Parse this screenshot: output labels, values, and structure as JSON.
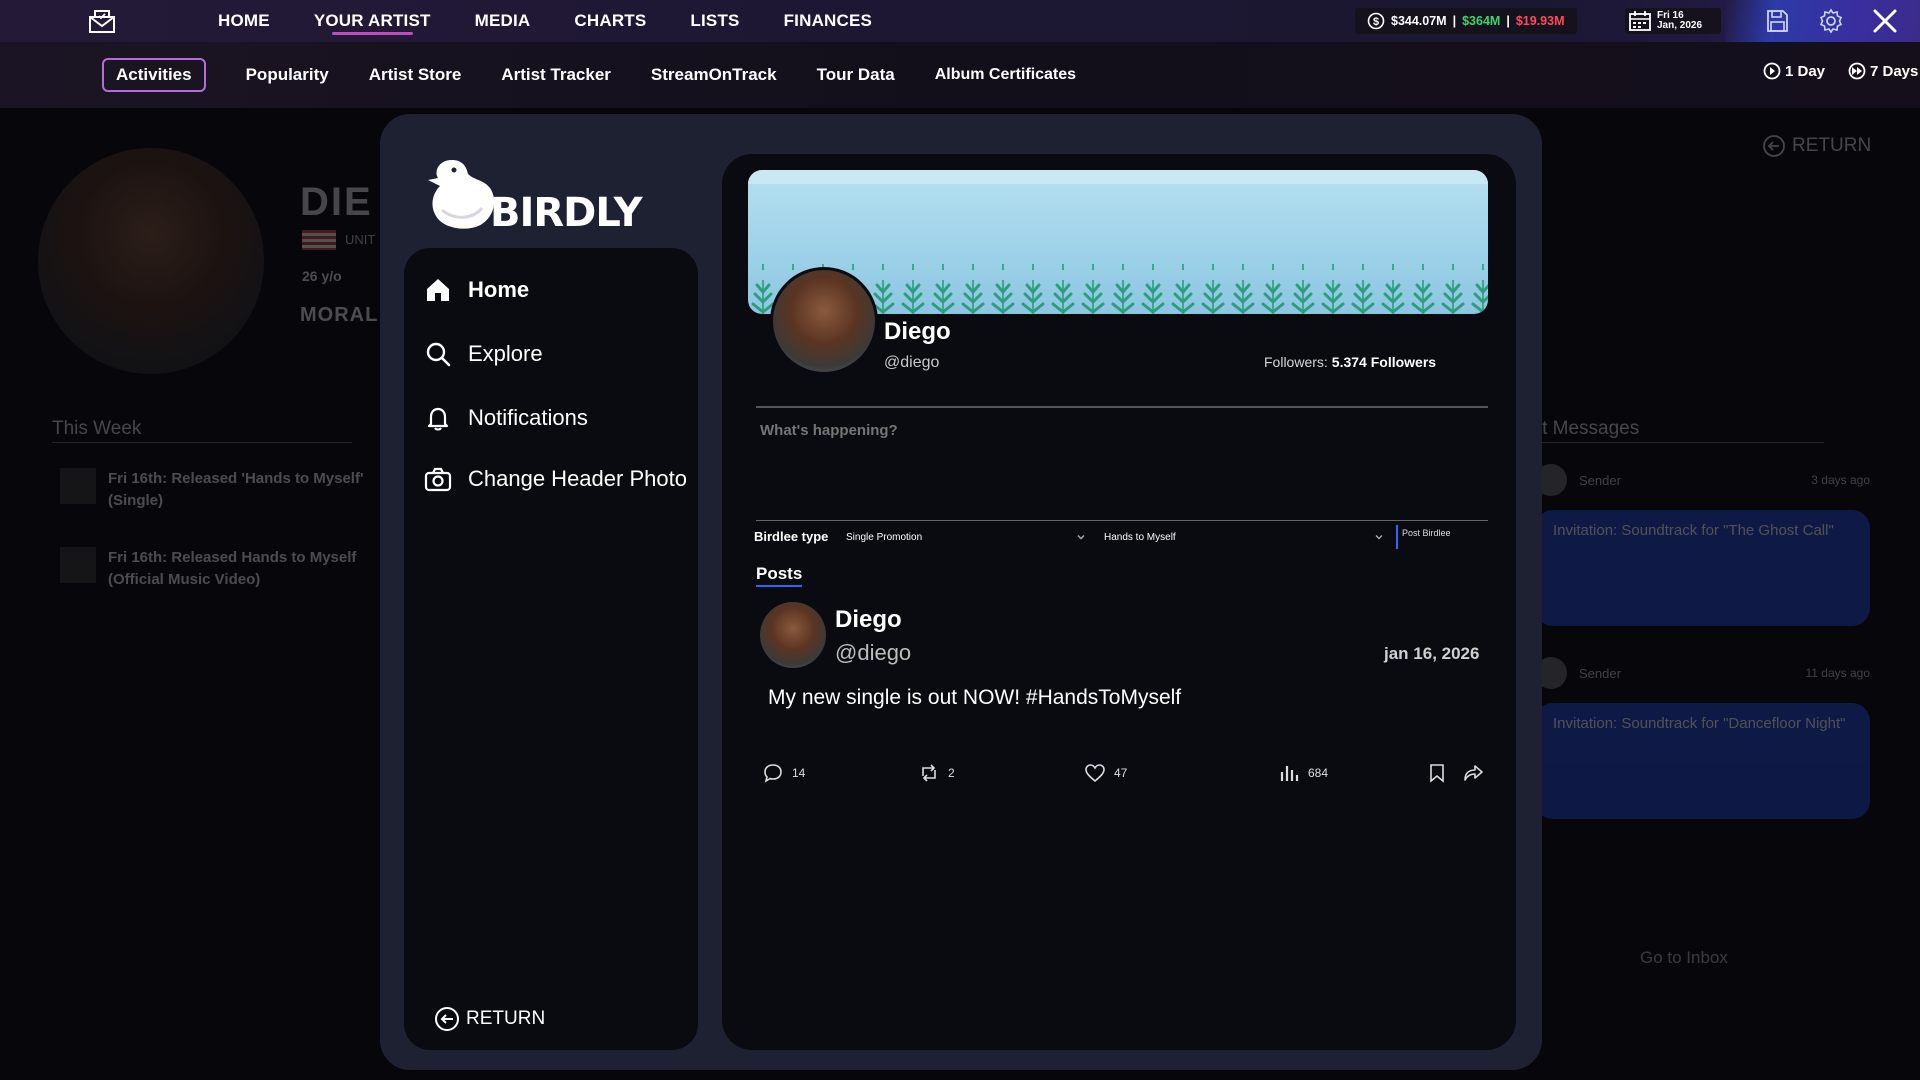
{
  "topnav": {
    "items": [
      "HOME",
      "YOUR ARTIST",
      "MEDIA",
      "CHARTS",
      "LISTS",
      "FINANCES"
    ],
    "active_index": 1
  },
  "finances": {
    "cash": "$344.07M",
    "income": "$364M",
    "expenses": "$19.93M",
    "separator": "|"
  },
  "date": {
    "line1": "Fri 16",
    "line2": "Jan, 2026"
  },
  "subnav": {
    "tabs": [
      "Activities",
      "Popularity",
      "Artist Store",
      "Artist Tracker",
      "StreamOnTrack",
      "Tour Data",
      "Album Certificates"
    ],
    "active_index": 0,
    "advance_1": "1 Day",
    "advance_7": "7 Days"
  },
  "background": {
    "name": "DIE",
    "country": "UNIT",
    "age": "26 y/o",
    "moral": "MORAL",
    "this_week": "This Week",
    "activities": [
      "Fri 16th: Released 'Hands to Myself' (Single)",
      "Fri 16th: Released Hands to Myself (Official Music Video)"
    ],
    "return_label": "RETURN",
    "messages_title": "ast Messages",
    "messages": [
      {
        "sender": "Sender",
        "ago": "3 days ago",
        "text": "Invitation: Soundtrack for \"The Ghost Call\""
      },
      {
        "sender": "Sender",
        "ago": "11 days ago",
        "text": "Invitation: Soundtrack for \"Dancefloor Night\""
      }
    ],
    "inbox": "Go to Inbox"
  },
  "birdly": {
    "logo": "BIRDLY",
    "menu": [
      "Home",
      "Explore",
      "Notifications",
      "Change Header Photo"
    ],
    "return_label": "RETURN"
  },
  "profile": {
    "name": "Diego",
    "handle": "@diego",
    "followers_label": "Followers:",
    "followers_value": "5.374 Followers"
  },
  "compose": {
    "placeholder": "What's happening?",
    "type_label": "Birdlee type",
    "type_value": "Single Promotion",
    "target_value": "Hands to Myself",
    "post_button": "Post Birdlee"
  },
  "posts": {
    "heading": "Posts",
    "items": [
      {
        "name": "Diego",
        "handle": "@diego",
        "date": "jan 16, 2026",
        "text": "My new single is out NOW! #HandsToMyself",
        "replies": "14",
        "reposts": "2",
        "likes": "47",
        "views": "684"
      }
    ]
  },
  "colors": {
    "accent": "#c04cc0",
    "income": "#3fd36b",
    "expenses": "#ff4a5a",
    "link_blue": "#2a67ff",
    "message_card": "#1d3fbf"
  }
}
